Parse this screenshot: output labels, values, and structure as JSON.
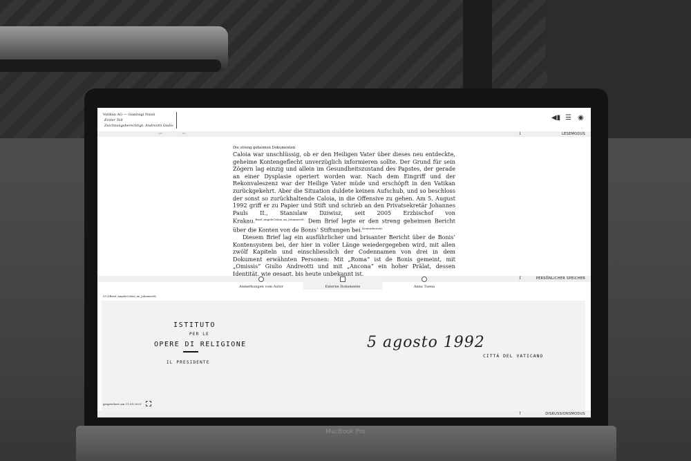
{
  "app": {
    "author_line": "Vatikan AG — Gianluigi Nuzzi",
    "part": "Erster Teil",
    "subtitle": "Zeichnungsberechtigt: Andreotti Giulio"
  },
  "toolbar": {
    "icons": [
      "back-icon",
      "list-icon",
      "eye-icon"
    ],
    "icon_glyphs": [
      "◀▮",
      "☰",
      "◉"
    ]
  },
  "ruler": {
    "left": "125",
    "right": "101"
  },
  "reading_bar": {
    "arrow": "↓",
    "label": "LESEMODUS"
  },
  "reading": {
    "kicker": "Die streng geheimen Dokumenten",
    "p1_a": "Caloia war unschlüssig, ob er den Heiligen Vater über dieses neu entdeckte, geheime Kontengeflecht unverzüglich informieren sollte. Der Grund für sein Zögern lag einzig und allein im Gesundheitszustand des Papstes, der gerade an einer Dysplasie operiert worden war. Nach dem Eingriff und der Rekonvaleszenz war der Heilige Vater müde und erschöpft in den Vatikan zurückgekehrt. Aber die Situation duldete keinen Aufschub, und so beschloss der sonst so zurückhaltende Caloia, in die Offensive zu gehen. Am 5. August 1992 griff er zu Papier und Stift und schrieb an den Privatsekretär Johannes Pauls II., Stanislaw Dziwisz, seit 2005 Erzbischof von Krakau.",
    "note1": "Brief_AngeloCaloia_an_Johannes0I.",
    "p1_b": " Dem Brief legte er den streng geheimen Bericht über die Konten von de Bonis’ Stiftungen bei.",
    "note2": "Kontenbericht",
    "p2": "Diesem Brief lag ein ausführlicher und brisanter Bericht über de Bonis’ Kontensystem bei, der hier in voller Länge weiedergegeben wird, mit allen zwölf Kapiteln und einschliesslich der Codennamen von drei in dem Dokument erwähnten Personen: Mit „Roma“ ist de Bonis gemeint, mit „Omissis“ Giulio Andreotti und mit „Ancona“ ein hoher Prälat, dessen Identität, wie gesagt, bis heute unbekannt ist."
  },
  "memory_bar": {
    "arrow": "↕",
    "label": "PERSÖNLICHER SPEICHER"
  },
  "tabs": [
    {
      "label": "Anmerkungen vom Autor"
    },
    {
      "label": "Externe Dokumente"
    },
    {
      "label": "Anna Tuena"
    }
  ],
  "document": {
    "caption": "03.3/Brief_AngeloCaloia_an_Johannes0I.",
    "letterhead_1": "ISTITUTO",
    "letterhead_2": "PER LE",
    "letterhead_3": "OPERE DI RELIGIONE",
    "letterhead_4": "IL PRESIDENTE",
    "date": "5 agosto 1992",
    "city": "CITTÀ DEL VATICANO",
    "saved": "gespeichert am 11.05.2021"
  },
  "discussion_bar": {
    "arrow": "↑",
    "label": "DISKUSSIONSMODUS"
  },
  "device": {
    "brand": "MacBook Pro"
  }
}
